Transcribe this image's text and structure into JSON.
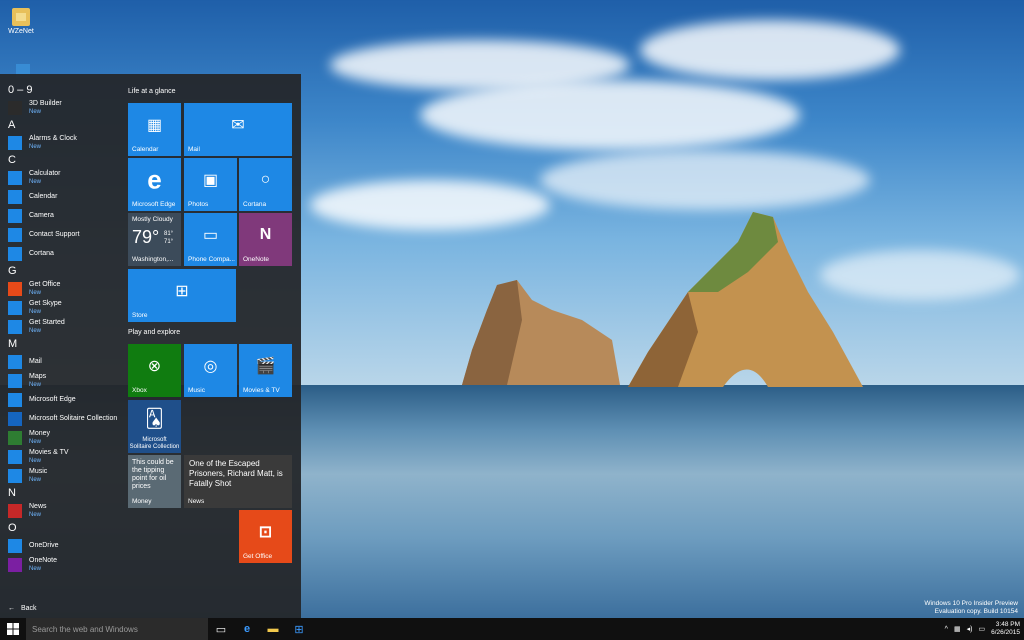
{
  "desktop": {
    "icon_label": "WZeNet"
  },
  "start_menu": {
    "apps": [
      {
        "section": "0 – 9"
      },
      {
        "name": "3D Builder",
        "new": "New",
        "color": "#2b2b2b",
        "icon": "3d-builder-icon"
      },
      {
        "section": "A"
      },
      {
        "name": "Alarms & Clock",
        "new": "New",
        "color": "#1e88e5",
        "icon": "alarm-clock-icon"
      },
      {
        "section": "C"
      },
      {
        "name": "Calculator",
        "new": "New",
        "color": "#1e88e5",
        "icon": "calculator-icon"
      },
      {
        "name": "Calendar",
        "new": "",
        "color": "#1e88e5",
        "icon": "calendar-icon"
      },
      {
        "name": "Camera",
        "new": "",
        "color": "#1e88e5",
        "icon": "camera-icon"
      },
      {
        "name": "Contact Support",
        "new": "",
        "color": "#1e88e5",
        "icon": "person-icon"
      },
      {
        "name": "Cortana",
        "new": "",
        "color": "#1e88e5",
        "icon": "cortana-icon"
      },
      {
        "section": "G"
      },
      {
        "name": "Get Office",
        "new": "New",
        "color": "#e64a19",
        "icon": "office-icon"
      },
      {
        "name": "Get Skype",
        "new": "New",
        "color": "#1e88e5",
        "icon": "skype-icon"
      },
      {
        "name": "Get Started",
        "new": "New",
        "color": "#1e88e5",
        "icon": "lightbulb-icon"
      },
      {
        "section": "M"
      },
      {
        "name": "Mail",
        "new": "",
        "color": "#1e88e5",
        "icon": "mail-icon"
      },
      {
        "name": "Maps",
        "new": "New",
        "color": "#1e88e5",
        "icon": "maps-icon"
      },
      {
        "name": "Microsoft Edge",
        "new": "",
        "color": "#1e88e5",
        "icon": "edge-icon"
      },
      {
        "name": "Microsoft Solitaire Collection",
        "new": "",
        "color": "#1565c0",
        "icon": "cards-icon"
      },
      {
        "name": "Money",
        "new": "New",
        "color": "#2e7d32",
        "icon": "money-chart-icon"
      },
      {
        "name": "Movies & TV",
        "new": "New",
        "color": "#1e88e5",
        "icon": "film-icon"
      },
      {
        "name": "Music",
        "new": "New",
        "color": "#1e88e5",
        "icon": "music-icon"
      },
      {
        "section": "N"
      },
      {
        "name": "News",
        "new": "New",
        "color": "#c62828",
        "icon": "news-icon"
      },
      {
        "section": "O"
      },
      {
        "name": "OneDrive",
        "new": "",
        "color": "#1e88e5",
        "icon": "onedrive-icon"
      },
      {
        "name": "OneNote",
        "new": "New",
        "color": "#7b1fa2",
        "icon": "onenote-icon"
      }
    ],
    "back_label": "Back",
    "groups": {
      "life": "Life at a glance",
      "play": "Play and explore"
    },
    "tiles": {
      "calendar": "Calendar",
      "mail": "Mail",
      "edge": "Microsoft Edge",
      "photos": "Photos",
      "cortana": "Cortana",
      "phone": "Phone Compa...",
      "onenote": "OneNote",
      "store": "Store",
      "xbox": "Xbox",
      "music": "Music",
      "movies": "Movies & TV",
      "solitaire_1": "Microsoft",
      "solitaire_2": "Solitaire Collection",
      "money_label": "Money",
      "money_text": "This could be the tipping point for oil prices",
      "news_label": "News",
      "news_text": "One of the Escaped Prisoners, Richard Matt, is Fatally Shot",
      "get_office": "Get Office"
    },
    "weather": {
      "condition": "Mostly Cloudy",
      "temp": "79°",
      "high": "81°",
      "low": "71°",
      "location": "Washington,..."
    }
  },
  "taskbar": {
    "search_placeholder": "Search the web and Windows",
    "time": "3:48 PM",
    "date": "6/26/2015"
  },
  "watermark": {
    "line1": "Windows 10 Pro Insider Preview",
    "line2": "Evaluation copy. Build 10154"
  }
}
